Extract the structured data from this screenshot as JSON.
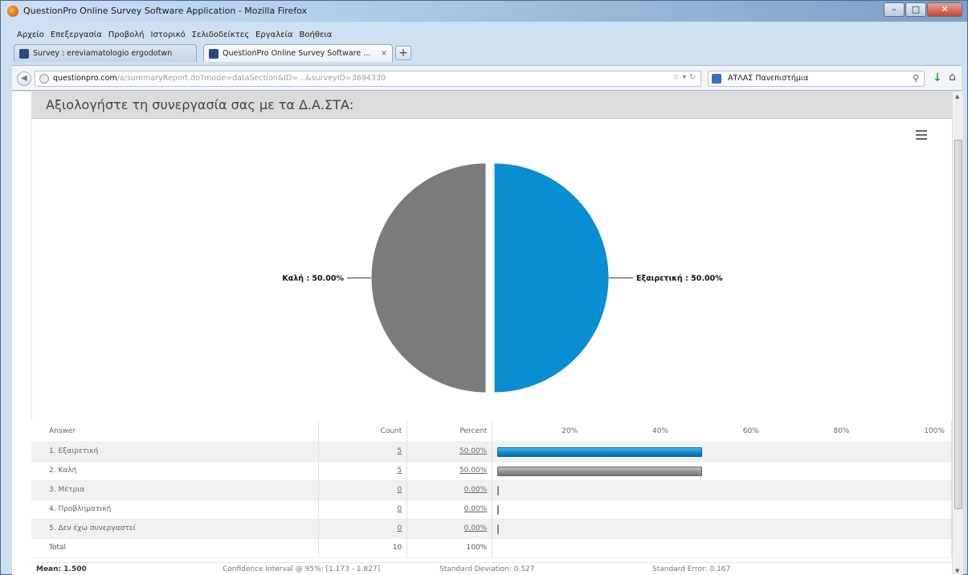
{
  "window": {
    "title": "QuestionPro Online Survey Software Application - Mozilla Firefox"
  },
  "menubar": [
    "Αρχείο",
    "Επεξεργασία",
    "Προβολή",
    "Ιστορικό",
    "Σελιδοδείκτες",
    "Εργαλεία",
    "Βοήθεια"
  ],
  "tabs": [
    {
      "label": "Survey : ereviamatologio ergodotwn",
      "active": false
    },
    {
      "label": "QuestionPro Online Survey Software ...",
      "active": true
    }
  ],
  "navbar": {
    "url_domain": "questionpro.com",
    "url_path": "/a/summaryReport.do?mode=dataSection&ID=...&surveyID=3694330",
    "search_text": "ΑΤΛΑΣ Πανεπιστήμια"
  },
  "question": {
    "title": "Αξιολογήστε τη συνεργασία σας με τα Δ.Α.ΣΤΑ:"
  },
  "chart_data": {
    "type": "pie",
    "slices": [
      {
        "label": "Εξαιρετική",
        "value": 50.0,
        "display": "Εξαιρετική : 50.00%",
        "color": "#0a8fd3"
      },
      {
        "label": "Καλή",
        "value": 50.0,
        "display": "Καλή : 50.00%",
        "color": "#7b7b7b"
      }
    ]
  },
  "table": {
    "headers": {
      "answer": "Answer",
      "count": "Count",
      "percent": "Percent"
    },
    "scale": [
      "20%",
      "40%",
      "60%",
      "80%",
      "100%"
    ],
    "rows": [
      {
        "num": "1.",
        "label": "Εξαιρετική",
        "count": "5",
        "percent": "50.00%",
        "value": 50,
        "color": "blue"
      },
      {
        "num": "2.",
        "label": "Καλή",
        "count": "5",
        "percent": "50.00%",
        "value": 50,
        "color": "gray"
      },
      {
        "num": "3.",
        "label": "Μέτρια",
        "count": "0",
        "percent": "0.00%",
        "value": 0,
        "color": "stub"
      },
      {
        "num": "4.",
        "label": "Προβληματική",
        "count": "0",
        "percent": "0.00%",
        "value": 0,
        "color": "stub"
      },
      {
        "num": "5.",
        "label": "Δεν έχω συνεργαστεί",
        "count": "0",
        "percent": "0.00%",
        "value": 0,
        "color": "stub"
      }
    ],
    "total": {
      "label": "Total",
      "count": "10",
      "percent": "100%"
    }
  },
  "stats": {
    "mean": "Mean: 1.500",
    "ci": "Confidence Interval @ 95%: [1.173 - 1.827]",
    "sd": "Standard Deviation: 0.527",
    "se": "Standard Error: 0.167"
  }
}
